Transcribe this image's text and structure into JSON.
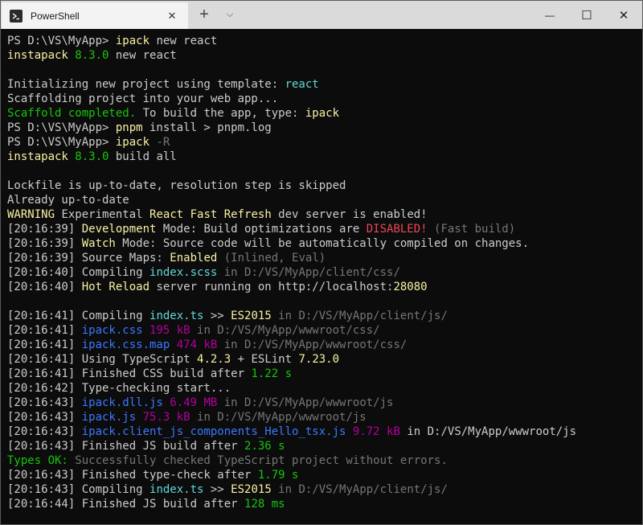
{
  "window": {
    "tab_title": "PowerShell",
    "tab_icon": "powershell-icon",
    "new_tab_label": "+",
    "dropdown_label": "⌵",
    "minimize_label": "—",
    "maximize_label": "☐",
    "close_label": "✕",
    "tab_close_label": "✕"
  },
  "terminal": {
    "colors": {
      "background": "#0c0c0c",
      "default": "#cccccc",
      "yellow": "#f9f1a5",
      "green": "#16c60c",
      "cyan": "#61d6d6",
      "gray": "#767676",
      "blue": "#3b78ff",
      "magenta": "#b4009e",
      "red": "#e74856"
    },
    "lines": [
      [
        [
          "PS D:\\VS\\MyApp> ",
          "default"
        ],
        [
          "ipack",
          "yellow"
        ],
        [
          " new react",
          "default"
        ]
      ],
      [
        [
          "instapack",
          "yellow"
        ],
        [
          " 8.3.0",
          "green"
        ],
        [
          " new react",
          "default"
        ]
      ],
      [],
      [
        [
          "Initializing new project using template: ",
          "default"
        ],
        [
          "react",
          "cyan"
        ]
      ],
      [
        [
          "Scaffolding project into your web app...",
          "default"
        ]
      ],
      [
        [
          "Scaffold completed.",
          "green"
        ],
        [
          " To build the app, type: ",
          "default"
        ],
        [
          "ipack",
          "yellow"
        ]
      ],
      [
        [
          "PS D:\\VS\\MyApp> ",
          "default"
        ],
        [
          "pnpm",
          "yellow"
        ],
        [
          " install > pnpm.log",
          "default"
        ]
      ],
      [
        [
          "PS D:\\VS\\MyApp> ",
          "default"
        ],
        [
          "ipack",
          "yellow"
        ],
        [
          " -R",
          "gray"
        ]
      ],
      [
        [
          "instapack",
          "yellow"
        ],
        [
          " 8.3.0",
          "green"
        ],
        [
          " build all",
          "default"
        ]
      ],
      [],
      [
        [
          "Lockfile is up-to-date, resolution step is skipped",
          "default"
        ]
      ],
      [
        [
          "Already up-to-date",
          "default"
        ]
      ],
      [
        [
          "WARNING",
          "yellow"
        ],
        [
          " Experimental ",
          "default"
        ],
        [
          "React Fast Refresh",
          "yellow"
        ],
        [
          " dev server is enabled!",
          "default"
        ]
      ],
      [
        [
          "[20:16:39] ",
          "default"
        ],
        [
          "Development",
          "yellow"
        ],
        [
          " Mode: Build optimizations are ",
          "default"
        ],
        [
          "DISABLED!",
          "red"
        ],
        [
          " (Fast build)",
          "gray"
        ]
      ],
      [
        [
          "[20:16:39] ",
          "default"
        ],
        [
          "Watch",
          "yellow"
        ],
        [
          " Mode: Source code will be automatically compiled on changes.",
          "default"
        ]
      ],
      [
        [
          "[20:16:39] ",
          "default"
        ],
        [
          "Source Maps: ",
          "default"
        ],
        [
          "Enabled",
          "yellow"
        ],
        [
          " (Inlined, Eval)",
          "gray"
        ]
      ],
      [
        [
          "[20:16:40] ",
          "default"
        ],
        [
          "Compiling ",
          "default"
        ],
        [
          "index.scss",
          "cyan"
        ],
        [
          " in D:/VS/MyApp/client/css/",
          "gray"
        ]
      ],
      [
        [
          "[20:16:40] ",
          "default"
        ],
        [
          "Hot Reload",
          "yellow"
        ],
        [
          " server running on http://localhost:",
          "default"
        ],
        [
          "28080",
          "yellow"
        ]
      ],
      [],
      [
        [
          "[20:16:41] ",
          "default"
        ],
        [
          "Compiling ",
          "default"
        ],
        [
          "index.ts",
          "cyan"
        ],
        [
          " >> ",
          "default"
        ],
        [
          "ES2015",
          "yellow"
        ],
        [
          " in D:/VS/MyApp/client/js/",
          "gray"
        ]
      ],
      [
        [
          "[20:16:41] ",
          "default"
        ],
        [
          "ipack.css",
          "blue"
        ],
        [
          " 195 kB",
          "magenta"
        ],
        [
          " in D:/VS/MyApp/wwwroot/css/",
          "gray"
        ]
      ],
      [
        [
          "[20:16:41] ",
          "default"
        ],
        [
          "ipack.css.map",
          "blue"
        ],
        [
          " 474 kB",
          "magenta"
        ],
        [
          " in D:/VS/MyApp/wwwroot/css/",
          "gray"
        ]
      ],
      [
        [
          "[20:16:41] ",
          "default"
        ],
        [
          "Using TypeScript ",
          "default"
        ],
        [
          "4.2.3",
          "yellow"
        ],
        [
          " + ESLint ",
          "default"
        ],
        [
          "7.23.0",
          "yellow"
        ]
      ],
      [
        [
          "[20:16:41] ",
          "default"
        ],
        [
          "Finished CSS build after ",
          "default"
        ],
        [
          "1.22 s",
          "green"
        ]
      ],
      [
        [
          "[20:16:42] ",
          "default"
        ],
        [
          "Type-checking start...",
          "default"
        ]
      ],
      [
        [
          "[20:16:43] ",
          "default"
        ],
        [
          "ipack.dll.js",
          "blue"
        ],
        [
          " 6.49 MB",
          "magenta"
        ],
        [
          " in D:/VS/MyApp/wwwroot/js",
          "gray"
        ]
      ],
      [
        [
          "[20:16:43] ",
          "default"
        ],
        [
          "ipack.js",
          "blue"
        ],
        [
          " 75.3 kB",
          "magenta"
        ],
        [
          " in D:/VS/MyApp/wwwroot/js",
          "gray"
        ]
      ],
      [
        [
          "[20:16:43] ",
          "default"
        ],
        [
          "ipack.client_js_components_Hello_tsx.js",
          "blue"
        ],
        [
          " 9.72 kB",
          "magenta"
        ],
        [
          " in D:/VS/MyApp/wwwroot/js",
          "default"
        ]
      ],
      [
        [
          "[20:16:43] ",
          "default"
        ],
        [
          "Finished JS build after ",
          "default"
        ],
        [
          "2.36 s",
          "green"
        ]
      ],
      [
        [
          "Types OK:",
          "green"
        ],
        [
          " Successfully checked TypeScript project without errors.",
          "gray"
        ]
      ],
      [
        [
          "[20:16:43] ",
          "default"
        ],
        [
          "Finished type-check after ",
          "default"
        ],
        [
          "1.79 s",
          "green"
        ]
      ],
      [
        [
          "[20:16:43] ",
          "default"
        ],
        [
          "Compiling ",
          "default"
        ],
        [
          "index.ts",
          "cyan"
        ],
        [
          " >> ",
          "default"
        ],
        [
          "ES2015",
          "yellow"
        ],
        [
          " in D:/VS/MyApp/client/js/",
          "gray"
        ]
      ],
      [
        [
          "[20:16:44] ",
          "default"
        ],
        [
          "Finished JS build after ",
          "default"
        ],
        [
          "128 ms",
          "green"
        ]
      ]
    ]
  }
}
